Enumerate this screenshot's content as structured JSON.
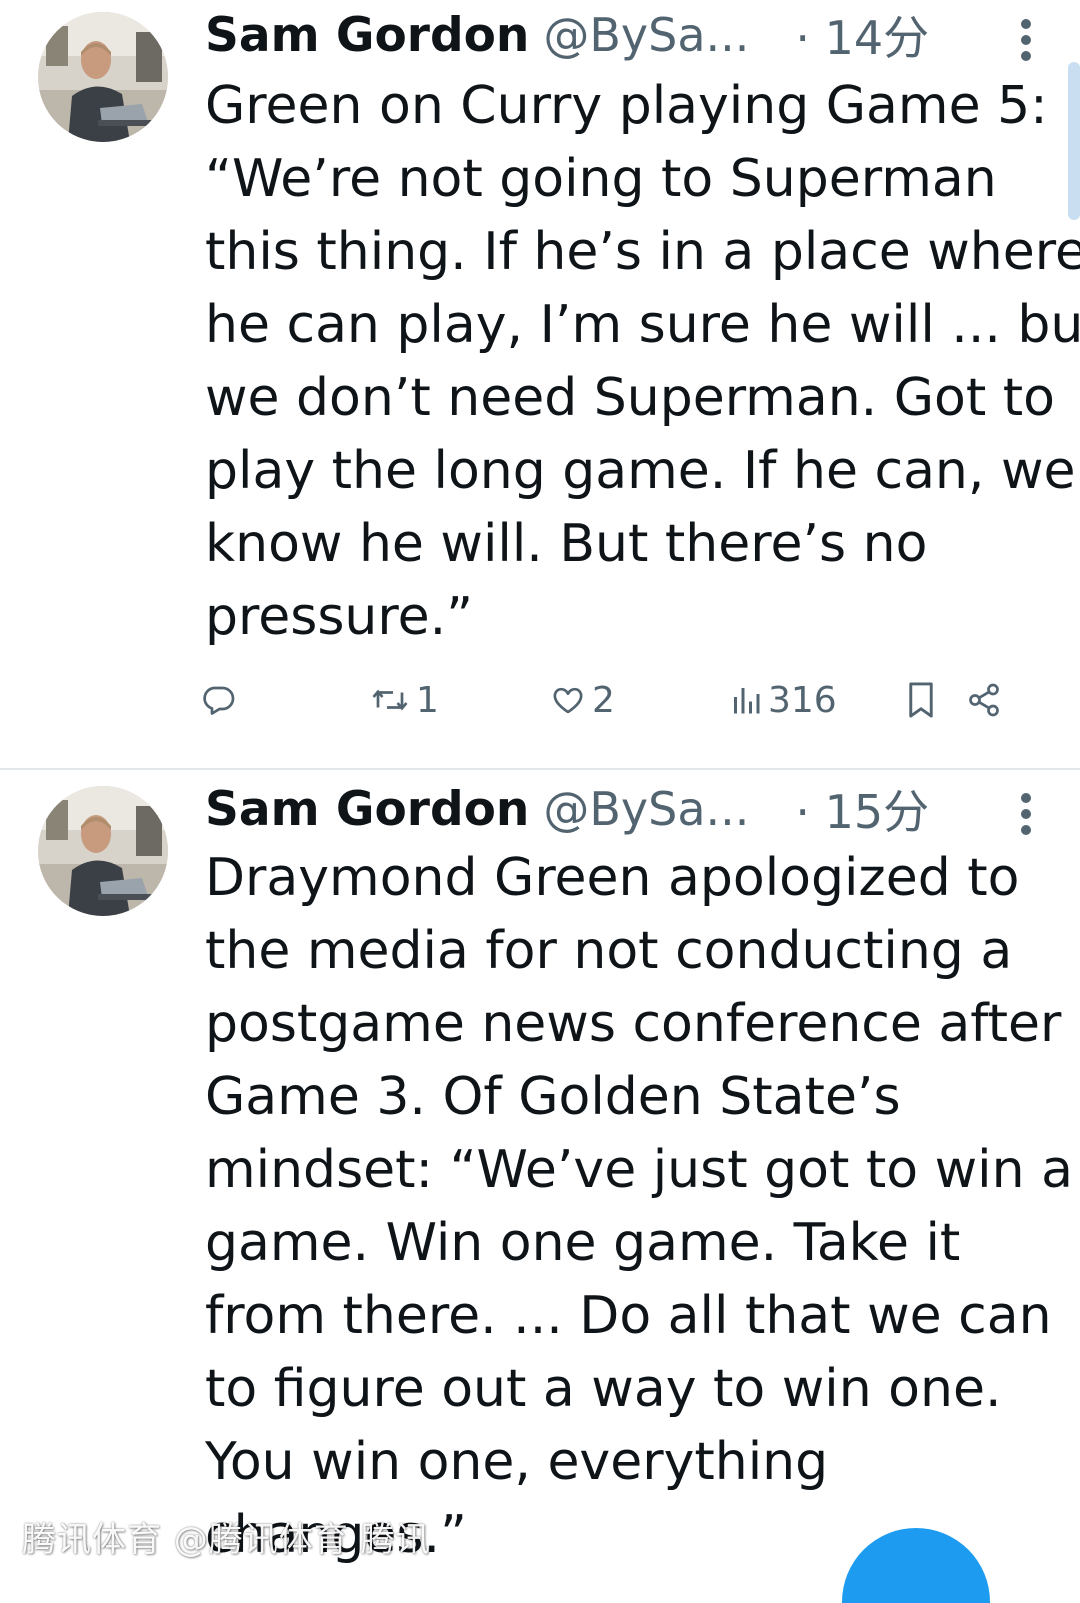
{
  "tweets": [
    {
      "author_name": "Sam Gordon",
      "handle": "@BySa...",
      "time": "· 14分",
      "text_lines": [
        "Green on Curry playing Game 5:",
        "“We’re not going to Superman",
        "this thing. If he’s in a place where",
        "he can play, I’m sure he will ... but",
        "we don’t need Superman. Got to",
        "play the long game. If he can, we",
        "know he will. But there’s no",
        "pressure.”"
      ],
      "actions": {
        "reply_count": "",
        "retweet_count": "1",
        "like_count": "2",
        "view_count": "316"
      },
      "icons": [
        "reply-icon",
        "retweet-icon",
        "like-icon",
        "views-icon",
        "bookmark-icon",
        "share-icon",
        "more-icon"
      ]
    },
    {
      "author_name": "Sam Gordon",
      "handle": "@BySa...",
      "time": "· 15分",
      "text_lines": [
        "Draymond Green apologized to",
        "the media for not conducting a",
        "postgame news conference after",
        "Game 3. Of Golden State’s",
        "mindset: “We’ve just got to win a",
        "game. Win one game. Take it",
        "from there. ... Do all that we can",
        "to figure out a way to win one.",
        "You win one, everything",
        "changes.”"
      ]
    }
  ],
  "watermark": "腾讯体育 @腾讯体育 腾讯",
  "colors": {
    "accent": "#1d9bf0",
    "text_primary": "#0f1419",
    "text_secondary": "#536471",
    "divider": "#e4e7ea"
  }
}
